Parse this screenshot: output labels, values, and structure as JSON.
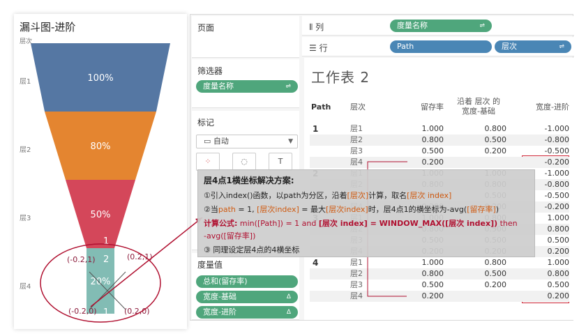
{
  "chart": {
    "title": "漏斗图-进阶",
    "axis_header": "层次",
    "levels": [
      "层1",
      "层2",
      "层3",
      "层4"
    ],
    "segments": [
      {
        "label": "100%",
        "color": "#5577a3"
      },
      {
        "label": "80%",
        "color": "#e48530"
      },
      {
        "label": "50%",
        "color": "#d4475a"
      },
      {
        "label": "20%",
        "color": "#82bcb4"
      }
    ],
    "point_labels": {
      "path1_top": "1",
      "path4_top": "4",
      "path2": "2",
      "path3": "3",
      "path1_bottom": "1",
      "path4_bottom": "4",
      "coord_top_left": "(-0.2,1)",
      "coord_top_right": "(0.2,1)",
      "coord_bottom_left": "(-0.2,0)",
      "coord_bottom_right": "(0.2,0)"
    }
  },
  "workspace": {
    "pages_label": "页面",
    "filters_label": "筛选器",
    "filter_pill": "度量名称",
    "marks_label": "标记",
    "mark_type": "自动",
    "measure_values_label": "度量值",
    "measure_pills": [
      "总和(留存率)",
      "宽度-基础",
      "宽度-进阶"
    ],
    "columns_label": "列",
    "rows_label": "行",
    "column_pill": "度量名称",
    "row_pills": [
      "Path",
      "层次"
    ],
    "sheet_title": "工作表 2",
    "table": {
      "headers": {
        "path": "Path",
        "level": "层次",
        "retention": "留存率",
        "width_base": "沿着 层次 的\n宽度-基础",
        "width_adv": "宽度-进阶"
      },
      "groups": [
        {
          "path": "1",
          "rows": [
            {
              "level": "层1",
              "retention": "1.000",
              "base": "0.800",
              "adv": "-1.000"
            },
            {
              "level": "层2",
              "retention": "0.800",
              "base": "0.500",
              "adv": "-0.800"
            },
            {
              "level": "层3",
              "retention": "0.500",
              "base": "0.200",
              "adv": "-0.500"
            },
            {
              "level": "层4",
              "retention": "0.200",
              "base": "",
              "adv": "-0.200"
            }
          ]
        },
        {
          "path": "2",
          "rows": [
            {
              "level": "层1",
              "retention": "1.000",
              "base": "1.000",
              "adv": "-1.000"
            },
            {
              "level": "层2",
              "retention": "0.800",
              "base": "0.800",
              "adv": "-0.800"
            },
            {
              "level": "层3",
              "retention": "0.500",
              "base": "0.500",
              "adv": "-0.500"
            },
            {
              "level": "层4",
              "retention": "0.200",
              "base": "0.200",
              "adv": "-0.200"
            }
          ]
        },
        {
          "path": "3",
          "rows": [
            {
              "level": "层1",
              "retention": "1.000",
              "base": "0.800",
              "adv": "1.000"
            },
            {
              "level": "层2",
              "retention": "0.800",
              "base": "0.500",
              "adv": "0.800"
            },
            {
              "level": "层3",
              "retention": "0.500",
              "base": "0.500",
              "adv": "0.500"
            },
            {
              "level": "层4",
              "retention": "0.200",
              "base": "0.200",
              "adv": "0.200"
            }
          ]
        },
        {
          "path": "4",
          "rows": [
            {
              "level": "层1",
              "retention": "1.000",
              "base": "0.800",
              "adv": "1.000"
            },
            {
              "level": "层2",
              "retention": "0.800",
              "base": "0.500",
              "adv": "0.800"
            },
            {
              "level": "层3",
              "retention": "0.500",
              "base": "0.200",
              "adv": "0.500"
            },
            {
              "level": "层4",
              "retention": "0.200",
              "base": "",
              "adv": "0.200"
            }
          ]
        }
      ]
    }
  },
  "callout": {
    "title": "层4点1横坐标解决方案:",
    "line1_a": "①引入index()函数，以path为分区，沿着",
    "line1_b": "[层次]",
    "line1_c": "计算，取名",
    "line1_d": "[层次 index]",
    "line2_a": "②当",
    "line2_b": "path",
    "line2_c": " = 1, ",
    "line2_d": "[层次index]",
    "line2_e": " = 最大",
    "line2_f": "[层次index]",
    "line2_g": "时，层4点1的横坐标为-avg(",
    "line2_h": "[留存率]",
    "line2_i": ")",
    "line3_a": "计算公式:",
    "line3_b": " min([Path]) = 1 and  ",
    "line3_c": "[层次 index] = WINDOW_MAX([层次 index])",
    "line3_d": "  then",
    "line4_a": "-avg(",
    "line4_b": "[留存率]",
    "line4_c": ")",
    "line5": "③ 同理设定层4点的4横坐标"
  }
}
